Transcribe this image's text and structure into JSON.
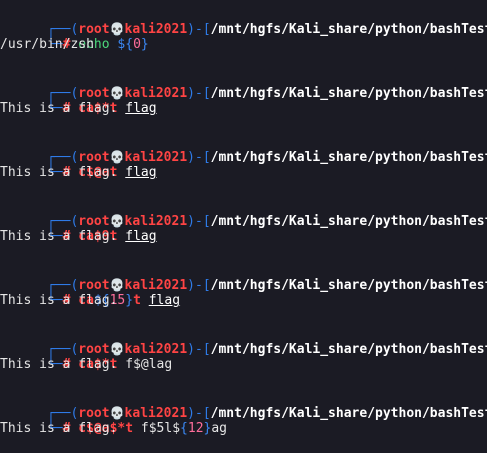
{
  "prompt": {
    "top_prefix": "┌──(",
    "bottom_prefix": "└─",
    "user": "root",
    "skull": "💀",
    "host": "kali2021",
    "mid": ")-[",
    "path": "/mnt/hgfs/Kali_share/python/bashTest",
    "close": "]",
    "hash": "#"
  },
  "commands": [
    {
      "parts": [
        " echo ",
        "${",
        "0",
        "}"
      ],
      "output": "/usr/bin/zsh"
    },
    {
      "parts": [
        " ca$*t ",
        "flag"
      ],
      "output": "This is a flag."
    },
    {
      "parts": [
        " c$@at ",
        "flag"
      ],
      "output": "This is a flag."
    },
    {
      "parts": [
        " ca$9t ",
        "flag"
      ],
      "output": "This is a flag."
    },
    {
      "parts": [
        " ca",
        "${",
        "15",
        "}",
        "t ",
        "flag"
      ],
      "output": "This is a flag."
    },
    {
      "parts": [
        " ca$*t ",
        "f$@lag"
      ],
      "output": "This is a flag."
    },
    {
      "parts": [
        " c$@a$*t ",
        "f$5l$",
        "{",
        "12",
        "}",
        "ag"
      ],
      "output": "This is a flag."
    }
  ]
}
